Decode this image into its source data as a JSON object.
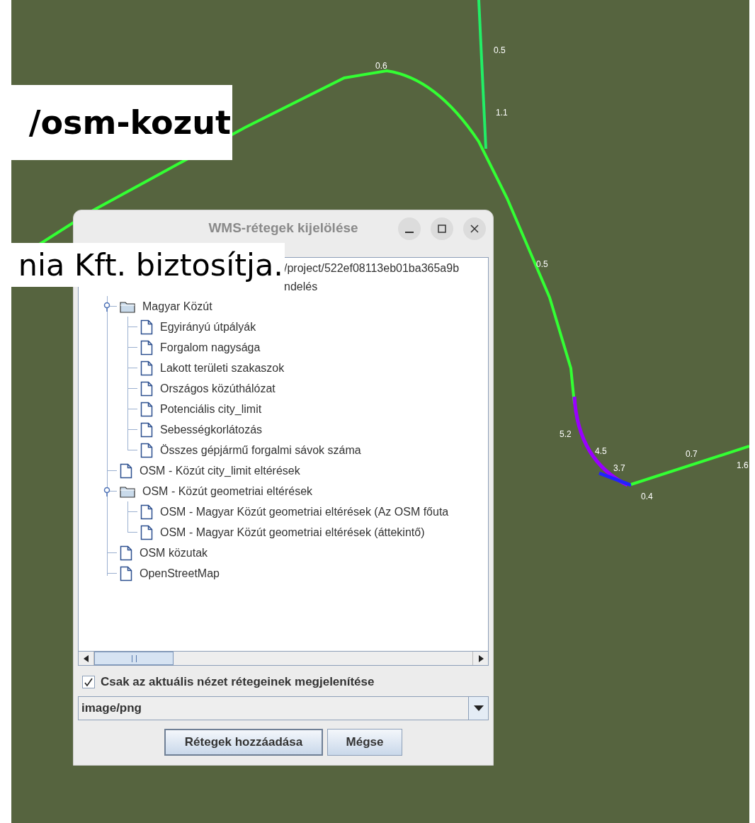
{
  "map": {
    "labels": [
      "0.6",
      "0.5",
      "1.1",
      "0.5",
      "5.2",
      "4.5",
      "3.7",
      "0.7",
      "1.6",
      "0.4"
    ]
  },
  "overlay_captions": [
    "/osm-kozut",
    "nia Kft. biztosítja."
  ],
  "dialog": {
    "title": "WMS-rétegek kijelölése",
    "tree": {
      "header_lines": [
        "/project/522ef08113eb01ba365a9b",
        "ndelés"
      ],
      "items": [
        {
          "label": "Magyar Közút",
          "kind": "folder",
          "expanded": true,
          "children": [
            {
              "label": "Egyirányú útpályák",
              "kind": "layer"
            },
            {
              "label": "Forgalom nagysága",
              "kind": "layer"
            },
            {
              "label": "Lakott területi szakaszok",
              "kind": "layer"
            },
            {
              "label": "Országos közúthálózat",
              "kind": "layer"
            },
            {
              "label": "Potenciális city_limit",
              "kind": "layer"
            },
            {
              "label": "Sebességkorlátozás",
              "kind": "layer"
            },
            {
              "label": "Összes gépjármű forgalmi sávok száma",
              "kind": "layer"
            }
          ]
        },
        {
          "label": "OSM - Közút city_limit eltérések",
          "kind": "layer"
        },
        {
          "label": "OSM - Közút geometriai eltérések",
          "kind": "folder",
          "expanded": true,
          "children": [
            {
              "label": "OSM - Magyar Közút geometriai eltérések (Az OSM főuta",
              "kind": "layer"
            },
            {
              "label": "OSM - Magyar Közút geometriai eltérések (áttekintő)",
              "kind": "layer"
            }
          ]
        },
        {
          "label": "OSM közutak",
          "kind": "layer"
        },
        {
          "label": "OpenStreetMap",
          "kind": "layer"
        }
      ]
    },
    "checkbox": {
      "label": "Csak az aktuális nézet rétegeinek megjelenítése",
      "checked": true
    },
    "format": {
      "value": "image/png"
    },
    "buttons": [
      "Rétegek hozzáadása",
      "Mégse"
    ]
  }
}
